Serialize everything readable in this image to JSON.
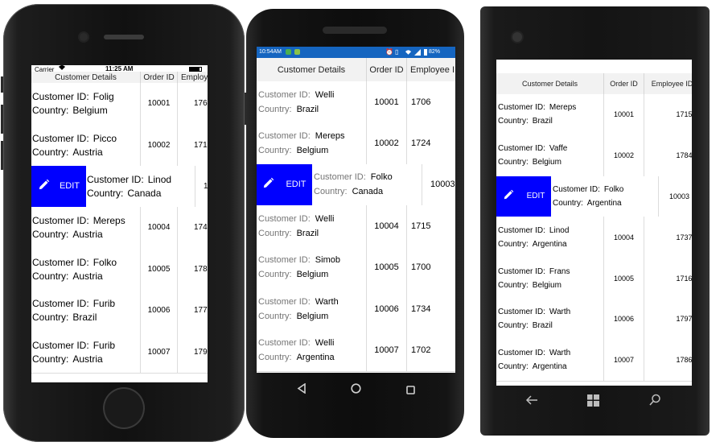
{
  "ios": {
    "status": {
      "carrier": "Carrier",
      "time": "11:25 AM"
    },
    "headers": [
      "Customer Details",
      "Order ID",
      "Employ"
    ],
    "edit_label": "EDIT",
    "rows": [
      {
        "customer_label": "Customer ID:",
        "customer": "Folig",
        "country_label": "Country:",
        "country": "Belgium",
        "order": "10001",
        "employee": "176"
      },
      {
        "customer_label": "Customer ID:",
        "customer": "Picco",
        "country_label": "Country:",
        "country": "Austria",
        "order": "10002",
        "employee": "171"
      },
      {
        "customer_label": "Customer ID:",
        "customer": "Linod",
        "country_label": "Country:",
        "country": "Canada",
        "order": "1",
        "employee": "",
        "swiped": true
      },
      {
        "customer_label": "Customer ID:",
        "customer": "Mereps",
        "country_label": "Country:",
        "country": "Austria",
        "order": "10004",
        "employee": "174"
      },
      {
        "customer_label": "Customer ID:",
        "customer": "Folko",
        "country_label": "Country:",
        "country": "Austria",
        "order": "10005",
        "employee": "178"
      },
      {
        "customer_label": "Customer ID:",
        "customer": "Furib",
        "country_label": "Country:",
        "country": "Brazil",
        "order": "10006",
        "employee": "177"
      },
      {
        "customer_label": "Customer ID:",
        "customer": "Furib",
        "country_label": "Country:",
        "country": "Austria",
        "order": "10007",
        "employee": "179"
      }
    ]
  },
  "android": {
    "status": {
      "time": "10:54AM",
      "battery": "82%"
    },
    "headers": [
      "Customer Details",
      "Order ID",
      "Employee I"
    ],
    "edit_label": "EDIT",
    "rows": [
      {
        "customer_label": "Customer ID:",
        "customer": "Welli",
        "country_label": "Country:",
        "country": "Brazil",
        "order": "10001",
        "employee": "1706"
      },
      {
        "customer_label": "Customer ID:",
        "customer": "Mereps",
        "country_label": "Country:",
        "country": "Belgium",
        "order": "10002",
        "employee": "1724"
      },
      {
        "customer_label": "Customer ID:",
        "customer": "Folko",
        "country_label": "Country:",
        "country": "Canada",
        "order": "10003",
        "employee": "",
        "swiped": true
      },
      {
        "customer_label": "Customer ID:",
        "customer": "Welli",
        "country_label": "Country:",
        "country": "Brazil",
        "order": "10004",
        "employee": "1715"
      },
      {
        "customer_label": "Customer ID:",
        "customer": "Simob",
        "country_label": "Country:",
        "country": "Belgium",
        "order": "10005",
        "employee": "1700"
      },
      {
        "customer_label": "Customer ID:",
        "customer": "Warth",
        "country_label": "Country:",
        "country": "Belgium",
        "order": "10006",
        "employee": "1734"
      },
      {
        "customer_label": "Customer ID:",
        "customer": "Welli",
        "country_label": "Country:",
        "country": "Argentina",
        "order": "10007",
        "employee": "1702"
      }
    ]
  },
  "windows": {
    "headers": [
      "Customer Details",
      "Order ID",
      "Employee ID"
    ],
    "edit_label": "EDIT",
    "rows": [
      {
        "customer_label": "Customer ID:",
        "customer": "Mereps",
        "country_label": "Country:",
        "country": "Brazil",
        "order": "10001",
        "employee": "1715"
      },
      {
        "customer_label": "Customer ID:",
        "customer": "Vaffe",
        "country_label": "Country:",
        "country": "Belgium",
        "order": "10002",
        "employee": "1784"
      },
      {
        "customer_label": "Customer ID:",
        "customer": "Folko",
        "country_label": "Country:",
        "country": "Argentina",
        "order": "10003",
        "employee": "",
        "swiped": true
      },
      {
        "customer_label": "Customer ID:",
        "customer": "Linod",
        "country_label": "Country:",
        "country": "Argentina",
        "order": "10004",
        "employee": "1737"
      },
      {
        "customer_label": "Customer ID:",
        "customer": "Frans",
        "country_label": "Country:",
        "country": "Belgium",
        "order": "10005",
        "employee": "1716"
      },
      {
        "customer_label": "Customer ID:",
        "customer": "Warth",
        "country_label": "Country:",
        "country": "Brazil",
        "order": "10006",
        "employee": "1797"
      },
      {
        "customer_label": "Customer ID:",
        "customer": "Warth",
        "country_label": "Country:",
        "country": "Argentina",
        "order": "10007",
        "employee": "1786"
      }
    ]
  },
  "colors": {
    "edit_bg": "#0000ff",
    "android_status": "#1565c0",
    "header_bg": "#f2f2f2"
  },
  "icons": {
    "edit": "pencil-icon",
    "android_back": "back-triangle-icon",
    "android_home": "home-circle-icon",
    "android_recent": "recent-square-icon",
    "win_back": "back-arrow-icon",
    "win_start": "windows-logo-icon",
    "win_search": "search-icon"
  }
}
